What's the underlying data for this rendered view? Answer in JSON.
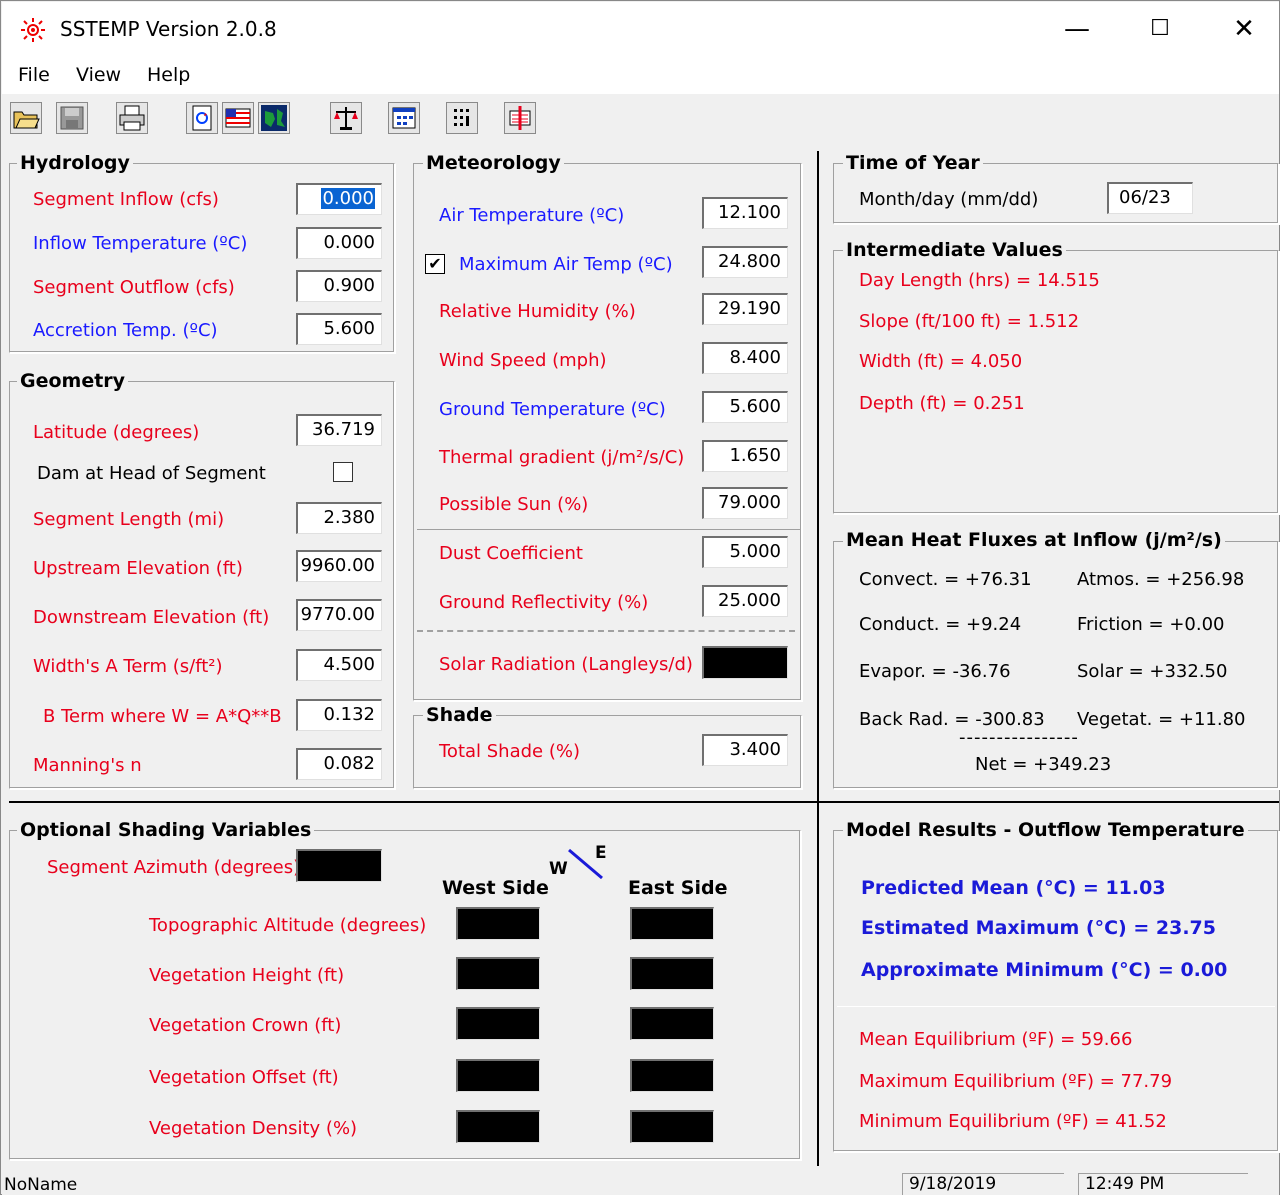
{
  "window": {
    "title": "SSTEMP Version 2.0.8",
    "minimize": "—",
    "maximize": "☐",
    "close": "✕"
  },
  "menu": [
    "File",
    "View",
    "Help"
  ],
  "toolbar": [
    {
      "name": "open-folder-icon"
    },
    {
      "name": "save-disk-icon"
    },
    {
      "name": "printer-icon"
    },
    {
      "name": "refresh-page-icon"
    },
    {
      "name": "us-flag-icon"
    },
    {
      "name": "globe-icon"
    },
    {
      "name": "balance-scale-icon"
    },
    {
      "name": "calculator-window-icon"
    },
    {
      "name": "grid-dots-icon"
    },
    {
      "name": "thermometer-chart-icon"
    }
  ],
  "hydrology": {
    "title": "Hydrology",
    "rows": [
      {
        "label": "Segment Inflow (cfs)",
        "value": "0.000",
        "color": "red",
        "selected": true
      },
      {
        "label": "Inflow Temperature (ºC)",
        "value": "0.000",
        "color": "blue"
      },
      {
        "label": "Segment Outflow (cfs)",
        "value": "0.900",
        "color": "red"
      },
      {
        "label": "Accretion Temp. (ºC)",
        "value": "5.600",
        "color": "blue"
      }
    ]
  },
  "geometry": {
    "title": "Geometry",
    "latitude_label": "Latitude (degrees)",
    "latitude": "36.719",
    "dam_label": "Dam at Head of Segment",
    "length_label": "Segment Length (mi)",
    "length": "2.380",
    "up_label": "Upstream Elevation (ft)",
    "up": "9960.00",
    "down_label": "Downstream Elevation (ft)",
    "down": "9770.00",
    "a_label": "Width's A Term (s/ft²)",
    "a": "4.500",
    "b_label": "B Term where W = A*Q**B",
    "b": "0.132",
    "n_label": "Manning's n",
    "n": "0.082"
  },
  "meteorology": {
    "title": "Meteorology",
    "air_label": "Air Temperature (ºC)",
    "air": "12.100",
    "max_label": "Maximum Air Temp (ºC)",
    "max_checked": "✔",
    "max": "24.800",
    "rh_label": "Relative Humidity (%)",
    "rh": "29.190",
    "wind_label": "Wind Speed (mph)",
    "wind": "8.400",
    "ground_label": "Ground Temperature (ºC)",
    "ground": "5.600",
    "therm_label": "Thermal gradient (j/m²/s/C)",
    "therm": "1.650",
    "sun_label": "Possible Sun (%)",
    "sun": "79.000",
    "dust_label": "Dust Coefficient",
    "dust": "5.000",
    "refl_label": "Ground Reflectivity (%)",
    "refl": "25.000",
    "solar_label": "Solar Radiation (Langleys/d)"
  },
  "shade": {
    "title": "Shade",
    "label": "Total Shade (%)",
    "value": "3.400"
  },
  "time": {
    "title": "Time of Year",
    "label": "Month/day (mm/dd)",
    "value": "06/23"
  },
  "intermediate": {
    "title": "Intermediate Values",
    "lines": [
      "Day Length (hrs) = 14.515",
      "Slope (ft/100 ft) = 1.512",
      "Width (ft) = 4.050",
      "Depth (ft) = 0.251"
    ]
  },
  "fluxes": {
    "title": "Mean Heat Fluxes at Inflow (j/m²/s)",
    "convect": "Convect. = +76.31",
    "atmos": "Atmos. = +256.98",
    "conduct": "Conduct. = +9.24",
    "friction": "Friction = +0.00",
    "evapor": "Evapor. = -36.76",
    "solar": "Solar = +332.50",
    "back": "Back Rad. = -300.83",
    "veget": "Vegetat. = +11.80",
    "dashes": "----------------",
    "net": "Net = +349.23"
  },
  "shading": {
    "title": "Optional Shading Variables",
    "azimuth_label": "Segment Azimuth (degrees)",
    "w": "W",
    "e": "E",
    "west": "West Side",
    "east": "East Side",
    "rows": [
      "Topographic Altitude (degrees)",
      "Vegetation Height (ft)",
      "Vegetation Crown (ft)",
      "Vegetation Offset (ft)",
      "Vegetation Density (%)"
    ]
  },
  "results": {
    "title": "Model Results - Outflow Temperature",
    "mean": "Predicted Mean (°C) = 11.03",
    "max": "Estimated Maximum (°C) = 23.75",
    "min": "Approximate Minimum (°C) = 0.00",
    "eq_mean": "Mean Equilibrium (ºF) = 59.66",
    "eq_max": "Maximum Equilibrium (ºF) = 77.79",
    "eq_min": "Minimum Equilibrium (ºF) = 41.52"
  },
  "status": {
    "file": "NoName",
    "date": "9/18/2019",
    "time": "12:49 PM"
  },
  "colors": {
    "red_label": "#e8001c",
    "blue_label": "#1a1aff",
    "result_blue": "#1a1ad8",
    "selection": "#0a64d2"
  }
}
